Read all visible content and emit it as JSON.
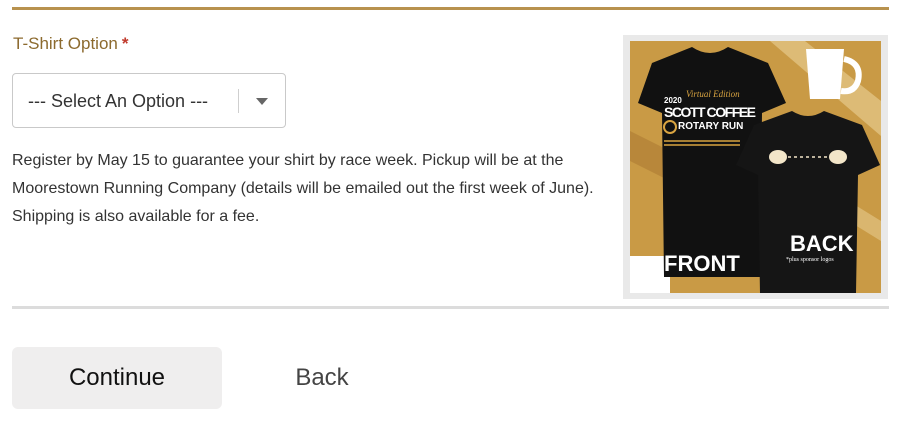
{
  "form": {
    "field_label": "T-Shirt Option",
    "required_mark": "*",
    "select": {
      "selected": "--- Select An Option ---"
    },
    "help_text": "Register by May 15 to guarantee your shirt by race week. Pickup will be at the Moorestown Running Company (details will be emailed out the first week of June). Shipping is also available for a fee."
  },
  "shirt_image": {
    "badge_line1": "2020",
    "badge_line2": "Virtual Edition",
    "title_line1": "SCOTT COFFEE",
    "title_line2": "ROTARY RUN",
    "front_label": "FRONT",
    "back_label": "BACK",
    "back_note": "*plus sponsor logos",
    "colors": {
      "gold": "#c99a45",
      "shirt": "#111111",
      "cream": "#f3e6c9"
    }
  },
  "actions": {
    "continue_label": "Continue",
    "back_label": "Back"
  }
}
